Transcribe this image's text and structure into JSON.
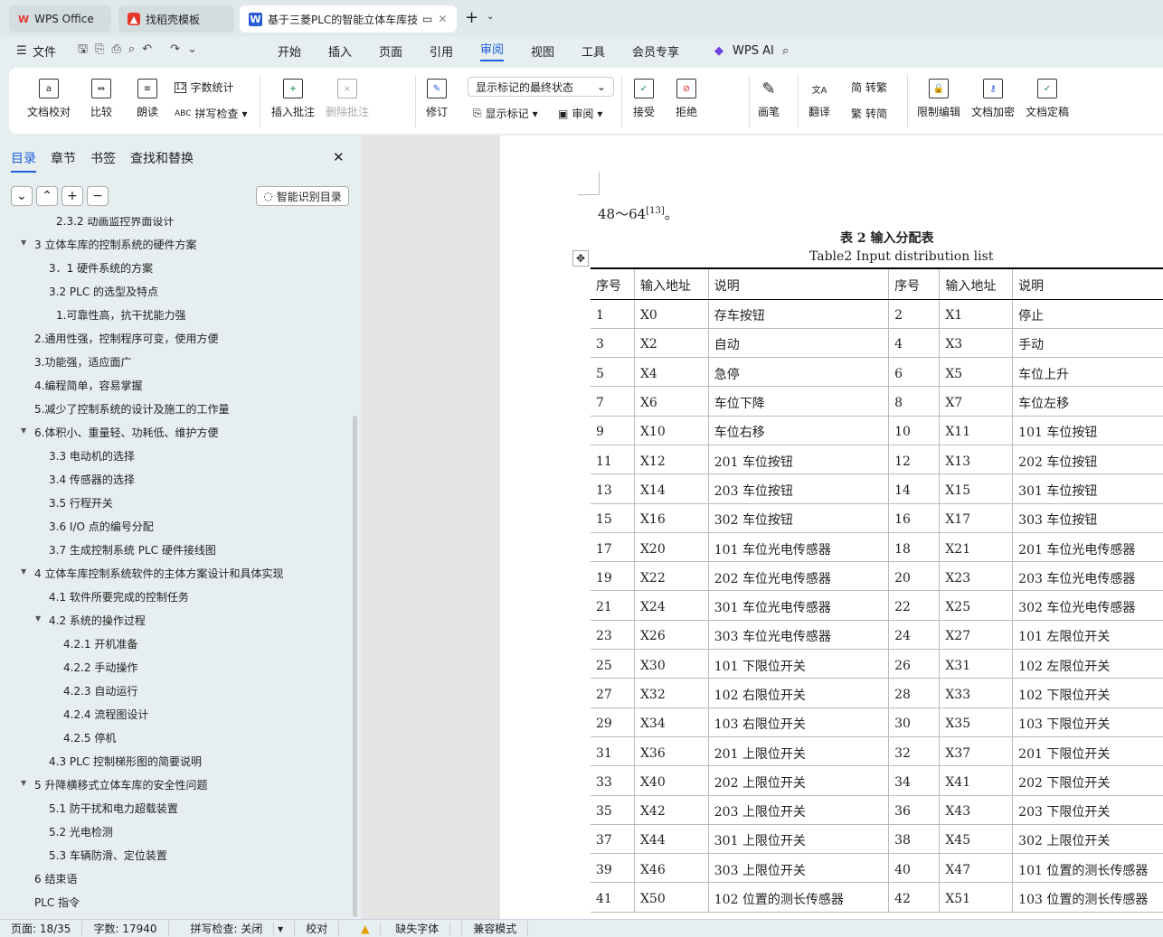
{
  "tabs": [
    {
      "label": "WPS Office"
    },
    {
      "label": "找稻壳模板"
    },
    {
      "label": "基于三菱PLC的智能立体车库技"
    }
  ],
  "menu": {
    "file": "文件",
    "items": [
      "开始",
      "插入",
      "页面",
      "引用",
      "审阅",
      "视图",
      "工具",
      "会员专享"
    ],
    "active": "审阅",
    "ai": "WPS AI"
  },
  "ribbon": {
    "proof": "文档校对",
    "compare": "比较",
    "read": "朗读",
    "wordcount": "字数统计",
    "spell": "拼写检查",
    "insert_comment": "插入批注",
    "delete_comment": "删除批注",
    "revise": "修订",
    "markup_state": "显示标记的最终状态",
    "show_markup": "显示标记",
    "review": "审阅",
    "accept": "接受",
    "reject": "拒绝",
    "pen": "画笔",
    "translate": "翻译",
    "to_trad": "转繁",
    "to_simp": "转简",
    "restrict": "限制编辑",
    "encrypt": "文档加密",
    "finalize": "文档定稿"
  },
  "panel": {
    "tabs": [
      "目录",
      "章节",
      "书签",
      "查找和替换"
    ],
    "smart_toc": "智能识别目录",
    "toc": [
      {
        "t": "2.3.2  动画监控界面设计",
        "l": 3
      },
      {
        "t": "3   立体车库的控制系统的硬件方案",
        "l": 1,
        "c": true
      },
      {
        "t": "3．1   硬件系统的方案",
        "l": 2
      },
      {
        "t": "3.2   PLC 的选型及特点",
        "l": 2
      },
      {
        "t": "1.可靠性高，抗干扰能力强",
        "l": 3
      },
      {
        "t": "2.通用性强，控制程序可变，使用方便",
        "l": 0
      },
      {
        "t": "3.功能强，适应面广",
        "l": 0
      },
      {
        "t": "4.编程简单，容易掌握",
        "l": 0
      },
      {
        "t": "5.减少了控制系统的设计及施工的工作量",
        "l": 0
      },
      {
        "t": "6.体积小、重量轻、功耗低、维护方便",
        "l": 0,
        "c": true
      },
      {
        "t": "3.3   电动机的选择",
        "l": 2
      },
      {
        "t": "3.4   传感器的选择",
        "l": 2
      },
      {
        "t": "3.5   行程开关",
        "l": 2
      },
      {
        "t": "3.6   I/O 点的编号分配",
        "l": 2
      },
      {
        "t": "3.7   生成控制系统 PLC 硬件接线图",
        "l": 2
      },
      {
        "t": "4   立体车库控制系统软件的主体方案设计和具体实现",
        "l": 1,
        "c": true
      },
      {
        "t": "4.1   软件所要完成的控制任务",
        "l": 2
      },
      {
        "t": "4.2   系统的操作过程",
        "l": 2,
        "c": true
      },
      {
        "t": "4.2.1   开机准备",
        "l": 4
      },
      {
        "t": "4.2.2   手动操作",
        "l": 4
      },
      {
        "t": "4.2.3   自动运行",
        "l": 4
      },
      {
        "t": "4.2.4   流程图设计",
        "l": 4
      },
      {
        "t": "4.2.5   停机",
        "l": 4
      },
      {
        "t": "4.3   PLC 控制梯形图的简要说明",
        "l": 2
      },
      {
        "t": "5   升降横移式立体车库的安全性问题",
        "l": 1,
        "c": true
      },
      {
        "t": "5.1   防干扰和电力超载装置",
        "l": 2
      },
      {
        "t": "5.2   光电检测",
        "l": 2
      },
      {
        "t": "5.3   车辆防滑、定位装置",
        "l": 2
      },
      {
        "t": "6   结束语",
        "l": 1
      },
      {
        "t": "PLC 指令",
        "l": 0
      }
    ]
  },
  "doc": {
    "prev_line": "48～64",
    "ref": "[13]",
    "prev_end": "。",
    "caption_cn": "表 2    输入分配表",
    "caption_en": "Table2    Input distribution list",
    "headers": [
      "序号",
      "输入地址",
      "说明",
      "序号",
      "输入地址",
      "说明"
    ],
    "rows": [
      [
        "1",
        "X0",
        "存车按钮",
        "2",
        "X1",
        "停止"
      ],
      [
        "3",
        "X2",
        "自动",
        "4",
        "X3",
        "手动"
      ],
      [
        "5",
        "X4",
        "急停",
        "6",
        "X5",
        "车位上升"
      ],
      [
        "7",
        "X6",
        "车位下降",
        "8",
        "X7",
        "车位左移"
      ],
      [
        "9",
        "X10",
        "车位右移",
        "10",
        "X11",
        "101 车位按钮"
      ],
      [
        "11",
        "X12",
        "201 车位按钮",
        "12",
        "X13",
        "202 车位按钮"
      ],
      [
        "13",
        "X14",
        "203 车位按钮",
        "14",
        "X15",
        "301 车位按钮"
      ],
      [
        "15",
        "X16",
        "302 车位按钮",
        "16",
        "X17",
        "303 车位按钮"
      ],
      [
        "17",
        "X20",
        "101 车位光电传感器",
        "18",
        "X21",
        "201 车位光电传感器"
      ],
      [
        "19",
        "X22",
        "202 车位光电传感器",
        "20",
        "X23",
        "203 车位光电传感器"
      ],
      [
        "21",
        "X24",
        "301 车位光电传感器",
        "22",
        "X25",
        "302 车位光电传感器"
      ],
      [
        "23",
        "X26",
        "303 车位光电传感器",
        "24",
        "X27",
        "101 左限位开关"
      ],
      [
        "25",
        "X30",
        "101 下限位开关",
        "26",
        "X31",
        "102 左限位开关"
      ],
      [
        "27",
        "X32",
        "102 右限位开关",
        "28",
        "X33",
        "102 下限位开关"
      ],
      [
        "29",
        "X34",
        "103 右限位开关",
        "30",
        "X35",
        "103 下限位开关"
      ],
      [
        "31",
        "X36",
        "201 上限位开关",
        "32",
        "X37",
        "201 下限位开关"
      ],
      [
        "33",
        "X40",
        "202 上限位开关",
        "34",
        "X41",
        "202 下限位开关"
      ],
      [
        "35",
        "X42",
        "203 上限位开关",
        "36",
        "X43",
        "203 下限位开关"
      ],
      [
        "37",
        "X44",
        "301 上限位开关",
        "38",
        "X45",
        "302 上限位开关"
      ],
      [
        "39",
        "X46",
        "303 上限位开关",
        "40",
        "X47",
        "101 位置的测长传感器"
      ],
      [
        "41",
        "X50",
        "102 位置的测长传感器",
        "42",
        "X51",
        "103 位置的测长传感器"
      ]
    ]
  },
  "status": {
    "page": "页面: 18/35",
    "words": "字数: 17940",
    "spell": "拼写检查: 关闭",
    "proof": "校对",
    "missing_font": "缺失字体",
    "compat": "兼容模式"
  },
  "colors": {
    "accent": "#1f5fe0",
    "wps_red": "#e8352c"
  }
}
